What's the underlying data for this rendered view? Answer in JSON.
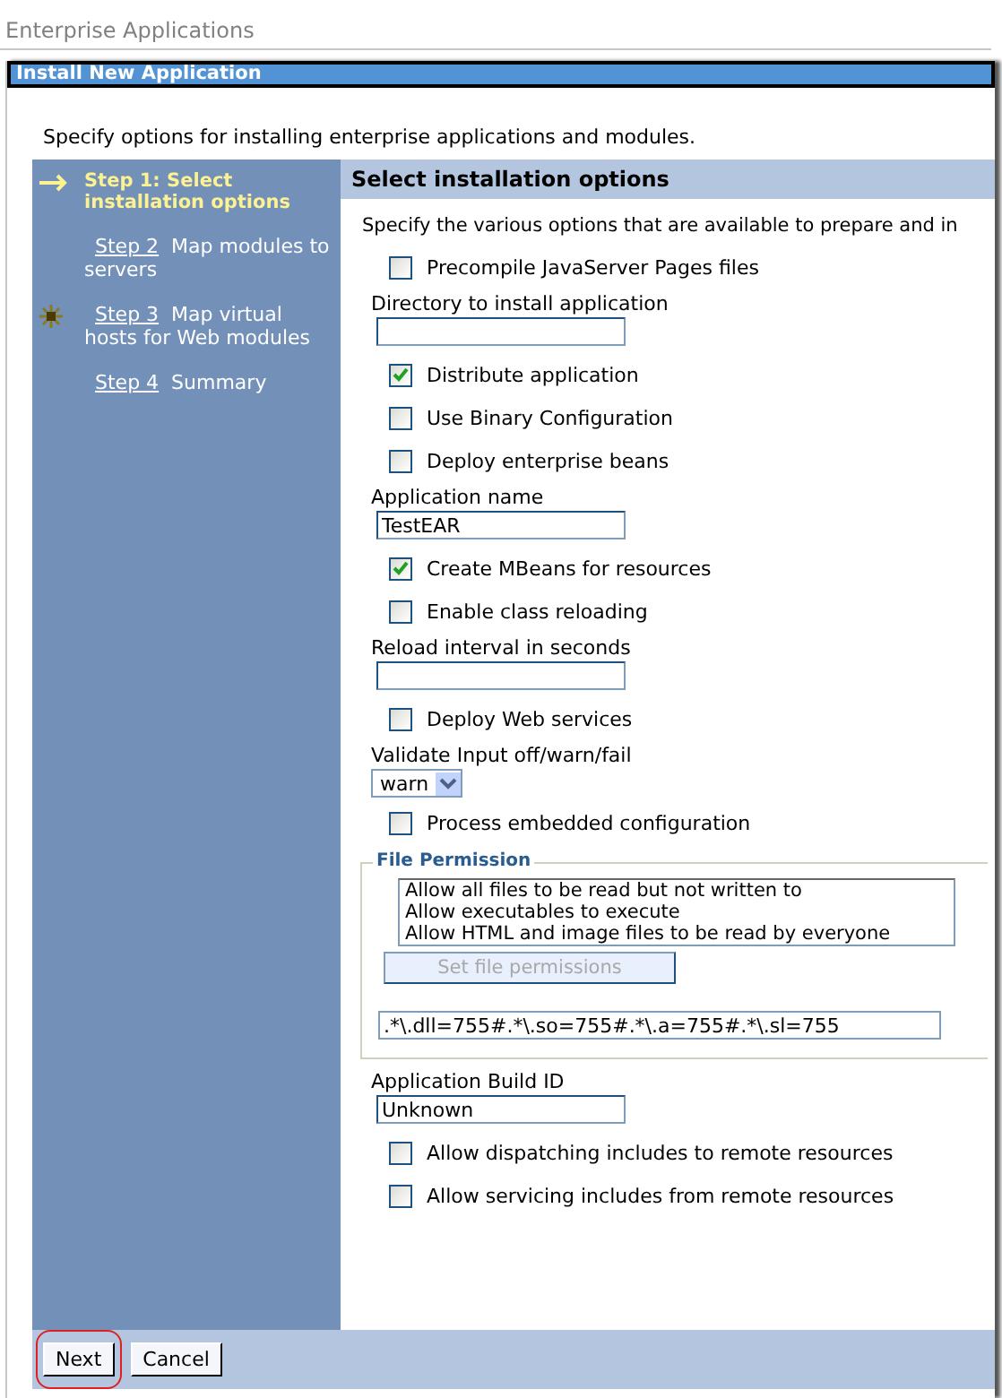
{
  "breadcrumb": "Enterprise Applications",
  "panel_title": "Install New Application",
  "intro": "Specify options for installing enterprise applications and modules.",
  "steps": [
    {
      "label": "Step 1: Select installation options",
      "current": true,
      "kind": "arrow"
    },
    {
      "link": "Step 2",
      "label": "Map modules to servers",
      "current": false,
      "kind": "plain"
    },
    {
      "link": "Step 3",
      "label": "Map virtual hosts for Web modules",
      "current": false,
      "kind": "star"
    },
    {
      "link": "Step 4",
      "label": "Summary",
      "current": false,
      "kind": "plain"
    }
  ],
  "section_title": "Select installation options",
  "section_intro": "Specify the various options that are available to prepare and in",
  "fields": [
    {
      "kind": "checkbox",
      "label": "Precompile JavaServer Pages files",
      "checked": false
    },
    {
      "kind": "text",
      "label": "Directory to install application"
    },
    {
      "kind": "checkbox",
      "label": "Distribute application",
      "checked": true
    },
    {
      "kind": "checkbox",
      "label": "Use Binary Configuration",
      "checked": false
    },
    {
      "kind": "checkbox",
      "label": "Deploy enterprise beans",
      "checked": false
    },
    {
      "kind": "text",
      "label": "Application name",
      "value": "TestEAR"
    },
    {
      "kind": "checkbox",
      "label": "Create MBeans for resources",
      "checked": true
    },
    {
      "kind": "checkbox",
      "label": "Enable class reloading",
      "checked": false
    },
    {
      "kind": "text",
      "label": "Reload interval in seconds"
    },
    {
      "kind": "checkbox",
      "label": "Deploy Web services",
      "checked": false
    },
    {
      "kind": "select",
      "label": "Validate Input off/warn/fail",
      "value": "warn"
    },
    {
      "kind": "checkbox",
      "label": "Process embedded configuration",
      "checked": false
    },
    {
      "kind": "fieldset",
      "legend": "File Permission",
      "options": [
        "Allow all files to be read but not written to",
        "Allow executables to execute",
        "Allow HTML and image files to be read by everyone"
      ],
      "button": {
        "label": "Set file permissions",
        "disabled": true
      },
      "value": ".*\\.dll=755#.*\\.so=755#.*\\.a=755#.*\\.sl=755"
    },
    {
      "kind": "text",
      "label": "Application Build ID",
      "value": "Unknown"
    },
    {
      "kind": "checkbox",
      "label": "Allow dispatching includes to remote resources",
      "checked": false
    },
    {
      "kind": "checkbox",
      "label": "Allow servicing includes from remote resources",
      "checked": false
    }
  ],
  "buttons": [
    {
      "label": "Next",
      "highlighted": true
    },
    {
      "label": "Cancel",
      "highlighted": false
    }
  ]
}
